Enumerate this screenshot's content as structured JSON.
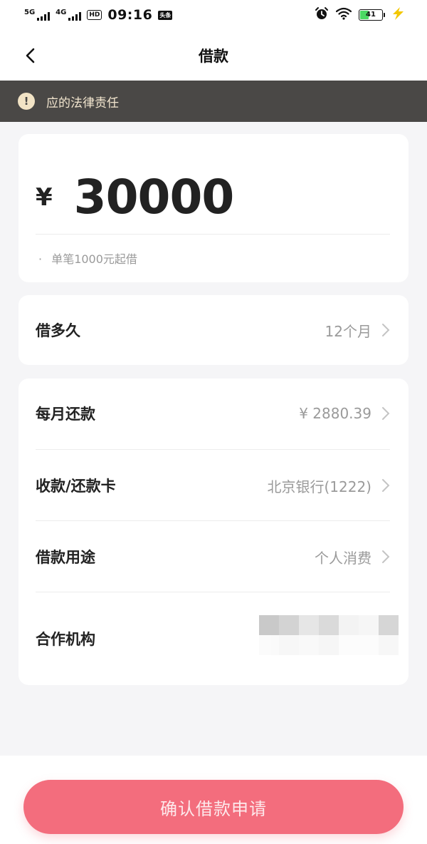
{
  "status_bar": {
    "network_1": "5G",
    "network_2": "4G",
    "hd_badge": "HD",
    "time": "09:16",
    "notification_badge": "头条",
    "battery_level": "41",
    "battery_fraction": 0.41,
    "icons": [
      "alarm-icon",
      "wifi-icon",
      "battery-icon",
      "charging-bolt-icon"
    ]
  },
  "nav": {
    "title": "借款",
    "back_icon": "chevron-left-icon"
  },
  "notice": {
    "icon": "exclamation-icon",
    "text": "应的法律责任"
  },
  "amount_card": {
    "currency": "¥",
    "amount": "30000",
    "hint_dot": "·",
    "hint": "单笔1000元起借"
  },
  "term": {
    "label": "借多久",
    "value": "12个月"
  },
  "details": {
    "monthly_payment": {
      "label": "每月还款",
      "value": "¥ 2880.39"
    },
    "card": {
      "label": "收款/还款卡",
      "value": "北京银行(1222)"
    },
    "purpose": {
      "label": "借款用途",
      "value": "个人消费"
    },
    "partner": {
      "label": "合作机构"
    }
  },
  "confirm_button": {
    "label": "确认借款申请"
  },
  "colors": {
    "accent": "#f36d7d",
    "notice_bg": "#4a4846",
    "notice_text": "#f3e6cf",
    "page_bg": "#f5f5f7"
  }
}
